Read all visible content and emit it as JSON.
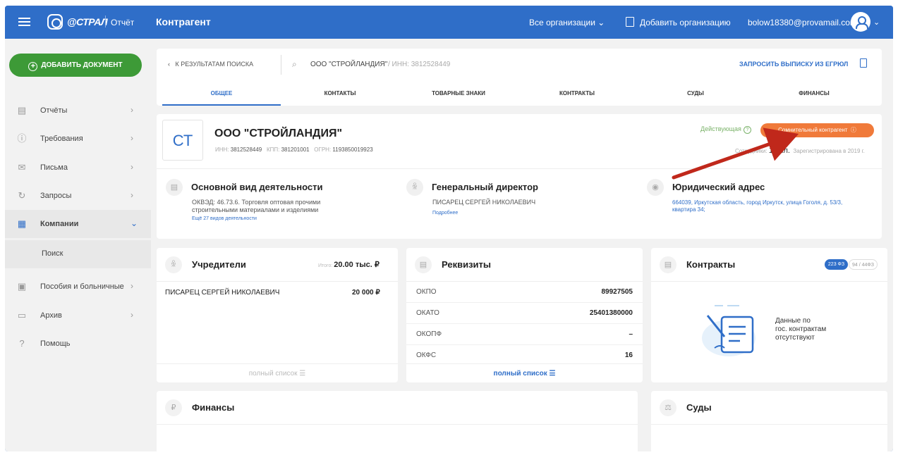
{
  "topbar": {
    "brand": "@СТРАЛ",
    "product": "Отчёт",
    "page_title": "Контрагент",
    "org_selector": "Все организации",
    "add_org": "Добавить организацию",
    "email": "bolow18380@provamail.com"
  },
  "sidebar": {
    "add_doc": "ДОБАВИТЬ ДОКУМЕНТ",
    "items": [
      {
        "label": "Отчёты"
      },
      {
        "label": "Требования"
      },
      {
        "label": "Письма"
      },
      {
        "label": "Запросы"
      },
      {
        "label": "Компании"
      },
      {
        "label": "Поиск"
      },
      {
        "label": "Пособия и больничные"
      },
      {
        "label": "Архив"
      },
      {
        "label": "Помощь"
      }
    ]
  },
  "search_bar": {
    "back": "К РЕЗУЛЬТАТАМ ПОИСКА",
    "name": "ООО \"СТРОЙЛАНДИЯ\"",
    "inn": " / ИНН: 3812528449",
    "egrul": "ЗАПРОСИТЬ ВЫПИСКУ ИЗ ЕГРЮЛ"
  },
  "tabs": [
    "ОБЩЕЕ",
    "КОНТАКТЫ",
    "ТОВАРНЫЕ ЗНАКИ",
    "КОНТРАКТЫ",
    "СУДЫ",
    "ФИНАНСЫ"
  ],
  "company": {
    "initials": "СТ",
    "name": "ООО \"СТРОЙЛАНДИЯ\"",
    "inn_label": "ИНН:",
    "inn": "3812528449",
    "kpp_label": "КПП:",
    "kpp": "381201001",
    "ogrn_label": "ОГРН:",
    "ogrn": "1193850019923",
    "status": "Действующая",
    "suspect_badge": "Сомнительный контрагент",
    "employees_label": "Сотрудники:",
    "employees": "1 чел.",
    "registered": "Зарегистрирована в 2019 г."
  },
  "activity": {
    "title": "Основной вид деятельности",
    "text": "ОКВЭД: 46.73.6. Торговля оптовая прочими строительными материалами и изделиями",
    "more": "Ещё 27 видов деятельности"
  },
  "director": {
    "title": "Генеральный директор",
    "name": "ПИСАРЕЦ СЕРГЕЙ НИКОЛАЕВИЧ",
    "more": "Подробнее"
  },
  "address": {
    "title": "Юридический адрес",
    "text": "664039, Иркутская область, город Иркутск, улица Гоголя, д. 53/3, квартира 34;"
  },
  "founders": {
    "title": "Учредители",
    "total_label": "Итого:",
    "total": "20.00 тыс. ₽",
    "rows": [
      {
        "name": "ПИСАРЕЦ СЕРГЕЙ НИКОЛАЕВИЧ",
        "amount": "20 000 ₽"
      }
    ],
    "full_list": "полный список ☰"
  },
  "requisites": {
    "title": "Реквизиты",
    "rows": [
      {
        "key": "ОКПО",
        "value": "89927505"
      },
      {
        "key": "ОКАТО",
        "value": "25401380000"
      },
      {
        "key": "ОКОПФ",
        "value": "–"
      },
      {
        "key": "ОКФС",
        "value": "16"
      }
    ],
    "full_list": "полный список ☰"
  },
  "contracts": {
    "title": "Контракты",
    "badge_active": "223 ФЗ",
    "badge_other": "94 / 44ФЗ",
    "nodata": [
      "Данные по",
      "гос. контрактам",
      "отсутствуют"
    ]
  },
  "finance": {
    "title": "Финансы"
  },
  "courts": {
    "title": "Суды"
  },
  "colors": {
    "header": "#2f6ec8",
    "add_doc": "#3d9a37",
    "suspect": "#f07a3a",
    "active_status": "#7bb36a",
    "annotation_arrow": "#c0281b"
  },
  "icons": [
    "menu-icon",
    "logo-icon",
    "chevron-down-icon",
    "building-icon",
    "user-avatar-icon",
    "plus-circle-icon",
    "document-icon",
    "exclamation-icon",
    "envelope-icon",
    "refresh-icon",
    "company-icon",
    "clipboard-icon",
    "archive-icon",
    "question-icon",
    "search-icon",
    "briefcase-icon",
    "person-icon",
    "location-pin-icon",
    "ruble-icon",
    "gavel-icon"
  ]
}
